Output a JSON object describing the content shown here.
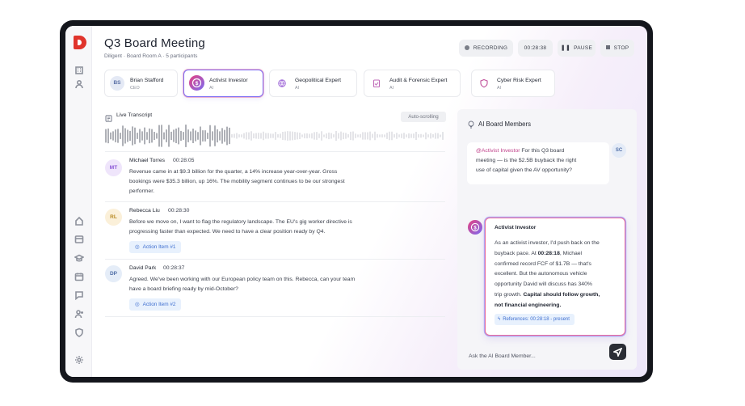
{
  "header": {
    "title": "Q3 Board Meeting",
    "subtitle": "Diligent · Board Room A · 5 participants",
    "recording_label": "RECORDING",
    "timer": "00:28:38",
    "pause_label": "PAUSE",
    "stop_label": "STOP"
  },
  "participants": [
    {
      "initials": "BS",
      "name": "Brian Stafford",
      "role": "CEO",
      "icon": "initials-avatar"
    },
    {
      "name": "Activist Investor",
      "role": "AI",
      "icon": "dollar-coin-icon",
      "active": true
    },
    {
      "name": "Geopolitical Expert",
      "role": "AI",
      "icon": "globe-icon"
    },
    {
      "name": "Audit & Forensic Expert",
      "role": "AI",
      "icon": "clipboard-check-icon"
    },
    {
      "name": "Cyber Risk Expert",
      "role": "AI",
      "icon": "shield-icon"
    }
  ],
  "transcript": {
    "label": "Live Transcript",
    "auto_scroll_label": "Auto-scrolling",
    "entries": [
      {
        "initials": "MT",
        "speaker": "Michael Torres",
        "time": "00:28:05",
        "lines": [
          "Revenue came in at $9.3 billion for the quarter, a 14% increase year-over-year. Gross",
          "bookings were $35.3 billion, up 16%. The mobility segment continues to be our strongest",
          "performer."
        ]
      },
      {
        "initials": "RL",
        "speaker": "Rebecca Liu",
        "time": "00:28:30",
        "lines": [
          "Before we move on, I want to flag the regulatory landscape. The EU's gig worker directive is",
          "progressing faster than expected. We need to have a clear position ready by Q4."
        ],
        "action": "Action Item #1"
      },
      {
        "initials": "DP",
        "speaker": "David Park",
        "time": "00:28:37",
        "lines": [
          "Agreed. We've been working with our European policy team on this. Rebecca, can your team",
          "have a board briefing ready by mid-October?"
        ],
        "action": "Action Item #2"
      }
    ]
  },
  "ai_panel": {
    "title": "AI Board Members",
    "user_message": {
      "initials": "SC",
      "mention": "@Activist Investor",
      "line1_rest": " For this Q3 board",
      "line2": "meeting — is the $2.5B buyback the right",
      "line3": "use of capital given the AV opportunity?"
    },
    "ai_reply": {
      "name": "Activist Investor",
      "l1": "As an activist investor, I'd push back on the",
      "l2a": "buyback pace. At ",
      "l2b": "00:28:18",
      "l2c": ", Michael",
      "l3": "confirmed record FCF of $1.7B — that's",
      "l4": "excellent. But the autonomous vehicle",
      "l5": "opportunity David will discuss has 340%",
      "l6a": "trip growth. ",
      "l6b": "Capital should follow growth,",
      "l7": "not financial engineering.",
      "reference": "References: 00:28:18 - present"
    },
    "input_placeholder": "Ask the AI Board Member..."
  },
  "colors": {
    "accent_purple": "#7b6cf3",
    "accent_pink": "#e5407f",
    "brand_red": "#e0342c",
    "link_blue": "#3f6fd0"
  }
}
